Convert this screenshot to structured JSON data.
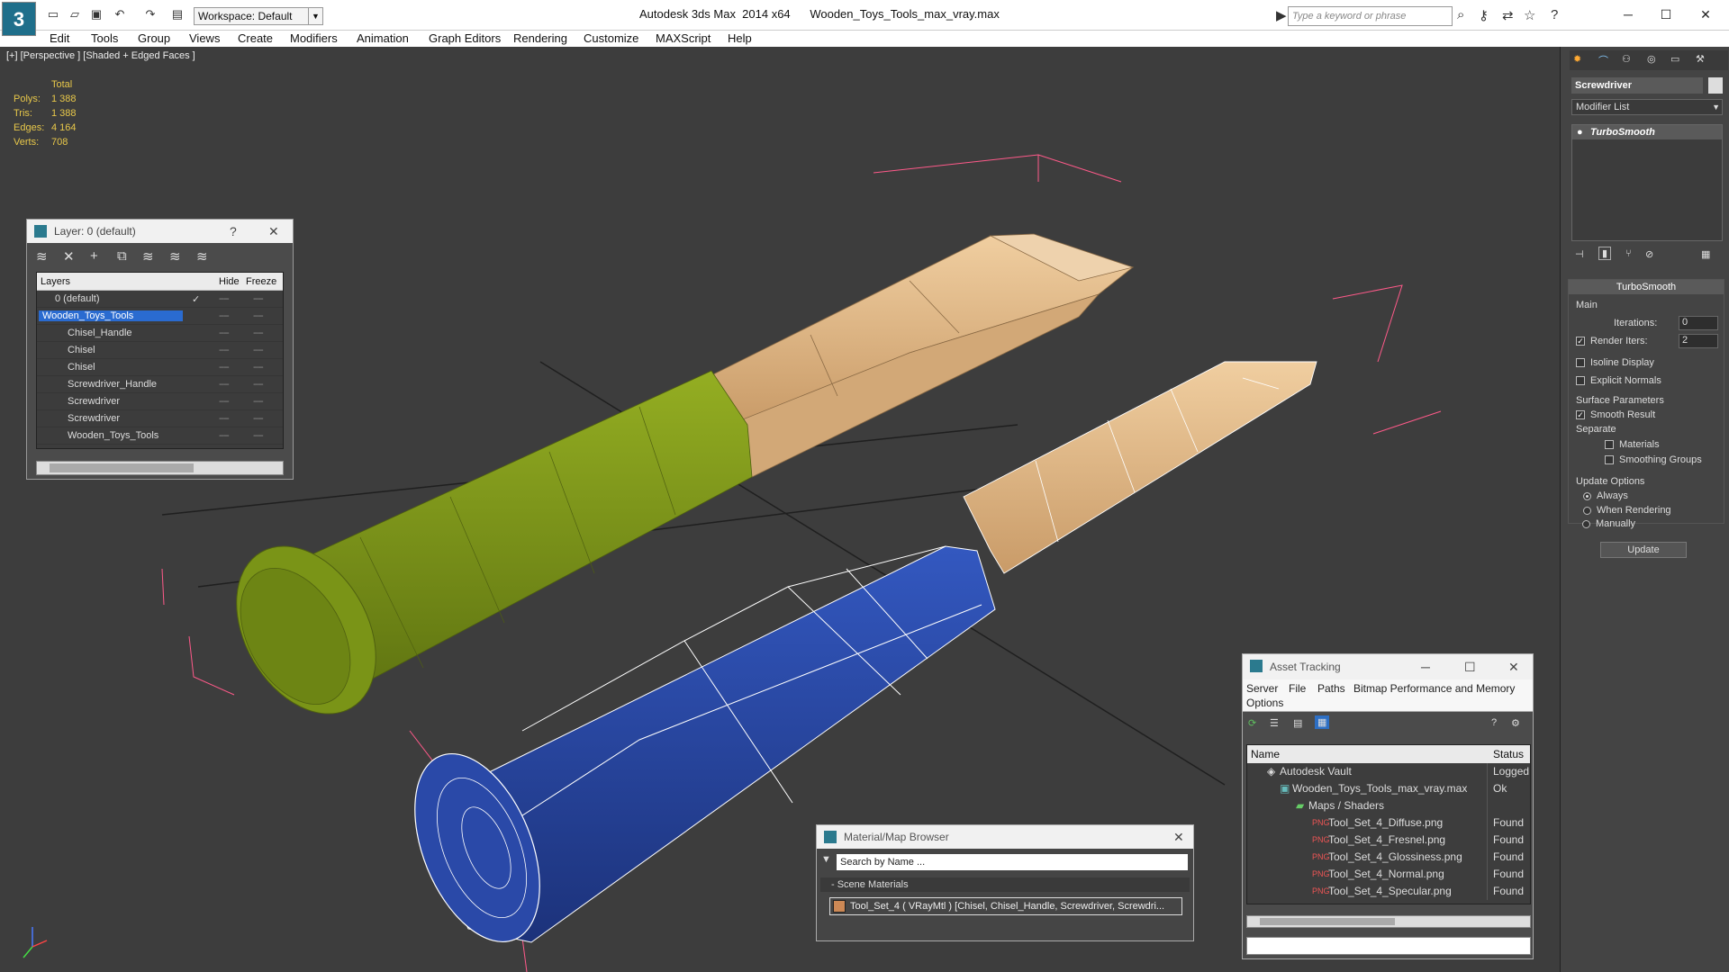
{
  "app": {
    "logo": "3",
    "workspace": "Workspace: Default",
    "title": "Autodesk 3ds Max  2014 x64      Wooden_Toys_Tools_max_vray.max",
    "search_placeholder": "Type a keyword or phrase"
  },
  "menu": [
    "Edit",
    "Tools",
    "Group",
    "Views",
    "Create",
    "Modifiers",
    "Animation",
    "Graph Editors",
    "Rendering",
    "Customize",
    "MAXScript",
    "Help"
  ],
  "viewport": {
    "label": "[+] [Perspective ] [Shaded + Edged Faces ]",
    "stats": {
      "header": "Total",
      "rows": [
        {
          "k": "Polys:",
          "v": "1 388"
        },
        {
          "k": "Tris:",
          "v": "1 388"
        },
        {
          "k": "Edges:",
          "v": "4 164"
        },
        {
          "k": "Verts:",
          "v": "708"
        }
      ]
    },
    "colors": {
      "bg": "#3d3d3d",
      "green": "#7f9a18",
      "wood": "#e2bd8c",
      "blue": "#2747a6",
      "selection": "#ff5a8a"
    }
  },
  "layer_window": {
    "title": "Layer: 0 (default)",
    "help": "?",
    "close": "✕",
    "columns": [
      "Layers",
      "Hide",
      "Freeze"
    ],
    "rows": [
      {
        "name": "0 (default)",
        "indent": 1,
        "check": "✓",
        "hide": "----",
        "freeze": "----"
      },
      {
        "name": "Wooden_Toys_Tools",
        "indent": 1,
        "selected": true,
        "hide": "----",
        "freeze": "----"
      },
      {
        "name": "Chisel_Handle",
        "indent": 2,
        "hide": "----",
        "freeze": "----"
      },
      {
        "name": "Chisel",
        "indent": 2,
        "hide": "----",
        "freeze": "----"
      },
      {
        "name": "Chisel",
        "indent": 2,
        "hide": "----",
        "freeze": "----"
      },
      {
        "name": "Screwdriver_Handle",
        "indent": 2,
        "hide": "----",
        "freeze": "----"
      },
      {
        "name": "Screwdriver",
        "indent": 2,
        "hide": "----",
        "freeze": "----"
      },
      {
        "name": "Screwdriver",
        "indent": 2,
        "hide": "----",
        "freeze": "----"
      },
      {
        "name": "Wooden_Toys_Tools",
        "indent": 2,
        "hide": "----",
        "freeze": "----"
      }
    ]
  },
  "asset_window": {
    "title": "Asset Tracking",
    "menu": [
      "Server",
      "File",
      "Paths",
      "Bitmap Performance and Memory",
      "Options"
    ],
    "columns": [
      "Name",
      "Status"
    ],
    "rows": [
      {
        "name": "Autodesk Vault",
        "status": "Logged",
        "indent": 1
      },
      {
        "name": "Wooden_Toys_Tools_max_vray.max",
        "status": "Ok",
        "indent": 2
      },
      {
        "name": "Maps / Shaders",
        "status": "",
        "indent": 3
      },
      {
        "name": "Tool_Set_4_Diffuse.png",
        "status": "Found",
        "indent": 4
      },
      {
        "name": "Tool_Set_4_Fresnel.png",
        "status": "Found",
        "indent": 4
      },
      {
        "name": "Tool_Set_4_Glossiness.png",
        "status": "Found",
        "indent": 4
      },
      {
        "name": "Tool_Set_4_Normal.png",
        "status": "Found",
        "indent": 4
      },
      {
        "name": "Tool_Set_4_Specular.png",
        "status": "Found",
        "indent": 4
      }
    ]
  },
  "material_browser": {
    "title": "Material/Map Browser",
    "search_placeholder": "Search by Name ...",
    "category": "- Scene Materials",
    "item": "Tool_Set_4  ( VRayMtl )  [Chisel, Chisel_Handle, Screwdriver, Screwdri..."
  },
  "command_panel": {
    "object_name": "Screwdriver",
    "modifier_list": "Modifier List",
    "stack_item": "TurboSmooth",
    "rollout": "TurboSmooth",
    "main": "Main",
    "iterations_label": "Iterations:",
    "iterations": "0",
    "render_iters_label": "Render Iters:",
    "render_iters": "2",
    "isoline": "Isoline Display",
    "explicit": "Explicit Normals",
    "surface": "Surface Parameters",
    "smooth_result": "Smooth Result",
    "separate": "Separate",
    "materials": "Materials",
    "smoothing": "Smoothing Groups",
    "update_options": "Update Options",
    "always": "Always",
    "when_rendering": "When Rendering",
    "manually": "Manually",
    "update_btn": "Update"
  }
}
